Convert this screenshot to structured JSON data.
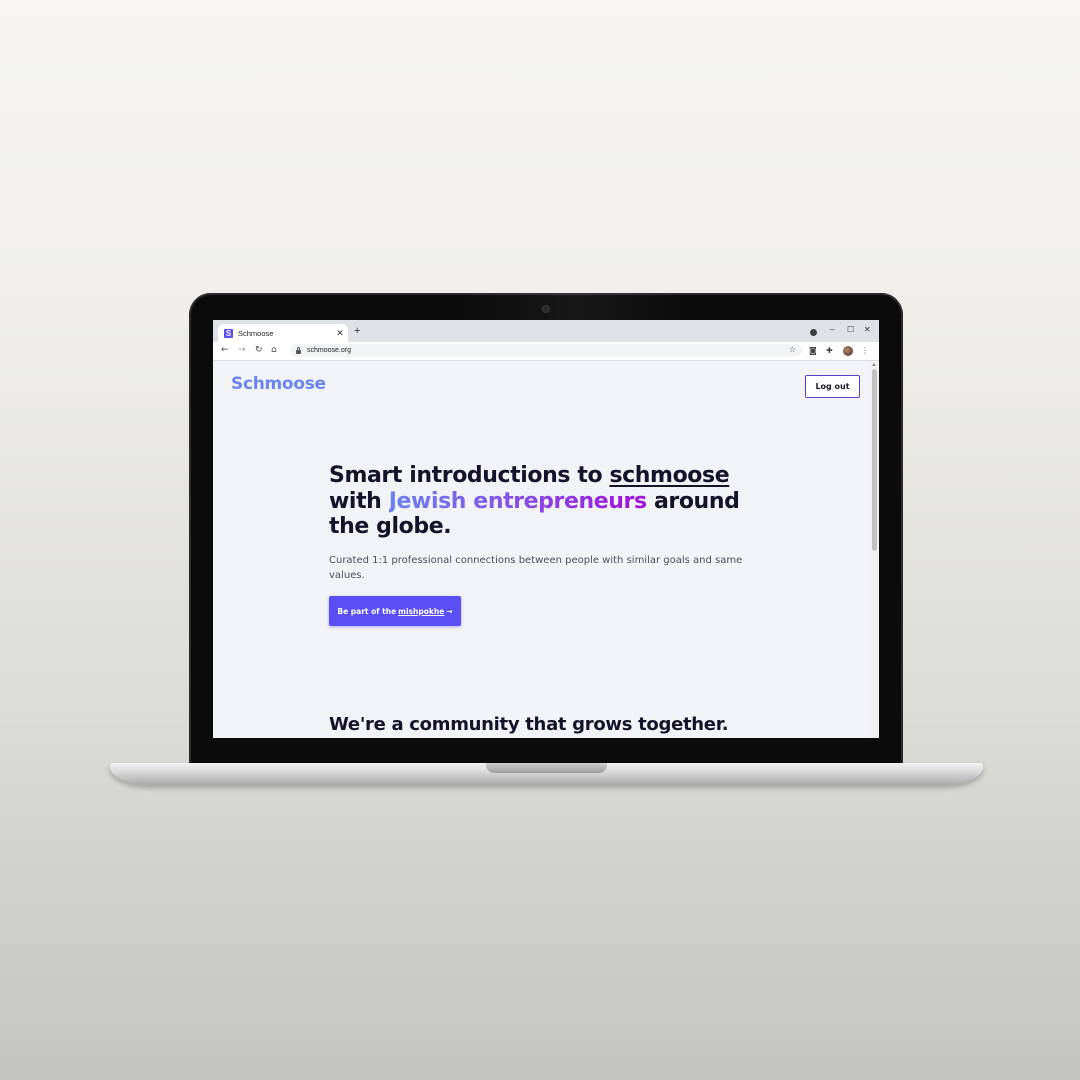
{
  "browser": {
    "tab_title": "Schmoose",
    "tab_favicon_letter": "S",
    "url": "schmoose.org"
  },
  "page": {
    "logo": "Schmoose",
    "logout_label": "Log out",
    "hero": {
      "title_part1": "Smart introductions to ",
      "title_link": "schmoose",
      "title_part2": " with ",
      "title_highlight": "Jewish entrepreneurs",
      "title_part3": " around the globe."
    },
    "subtitle": "Curated 1:1 professional connections between people with similar goals and same values.",
    "cta": {
      "prefix": "Be part of the ",
      "link": "mishpokhe",
      "arrow": "→"
    },
    "section_title": "We're a community that grows together."
  },
  "colors": {
    "logo": "#6c84f0",
    "cta_bg": "#5a4ff5",
    "logout_border": "#5b3fc4",
    "gradient_start": "#6a82ef",
    "gradient_end": "#a010d8",
    "heading": "#15132a"
  },
  "icons": [
    "favicon",
    "close-icon",
    "new-tab-icon",
    "back-icon",
    "forward-icon",
    "reload-icon",
    "home-icon",
    "lock-icon",
    "bookmark-star-icon",
    "extension-icon",
    "puzzle-icon",
    "profile-avatar",
    "menu-dots-icon",
    "minimize-icon",
    "maximize-icon",
    "window-close-icon"
  ]
}
